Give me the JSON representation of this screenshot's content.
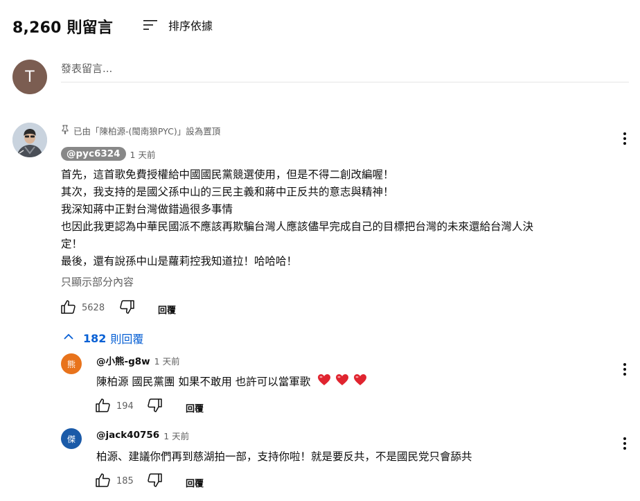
{
  "header": {
    "comment_count_title": "8,260 則留言",
    "sort_label": "排序依據"
  },
  "composer": {
    "avatar_letter": "T",
    "placeholder": "發表留言...",
    "avatar_color": "#7b5d51"
  },
  "pinned_comment": {
    "pinned_text": "已由「陳柏源-(閩南狼PYC)」設為置頂",
    "author": "@pyc6324",
    "time": "1 天前",
    "body_lines": [
      "首先，這首歌免費授權給中國國民黨競選使用，但是不得二創改編喔！",
      "其次，我支持的是國父孫中山的三民主義和蔣中正反共的意志與精神！",
      "我深知蔣中正對台灣做錯過很多事情",
      "也因此我更認為中華民國派不應該再欺騙台灣人應該儘早完成自己的目標把台灣的未來還給台灣人決",
      "定！",
      "最後，還有說孫中山是蘿莉控我知道拉！哈哈哈！"
    ],
    "read_more": "只顯示部分內容",
    "likes": "5628",
    "reply_label": "回覆"
  },
  "replies_toggle": {
    "count": "182",
    "label": "則回覆"
  },
  "replies": [
    {
      "avatar_char": "熊",
      "avatar_color": "#e8731c",
      "author": "@小熊-g8w",
      "time": "1 天前",
      "text": "陳柏源  國民黨團 如果不敢用 也許可以當軍歌",
      "hearts": 3,
      "likes": "194",
      "reply_label": "回覆"
    },
    {
      "avatar_char": "傑",
      "avatar_color": "#1a5aa8",
      "author": "@jack40756",
      "time": "1 天前",
      "text": "柏源、建議你們再到慈湖拍一部，支持你啦！就是要反共，不是國民党只會舔共",
      "hearts": 0,
      "likes": "185",
      "reply_label": "回覆"
    }
  ],
  "colors": {
    "link_blue": "#065fd4",
    "secondary_text": "#606060",
    "heart_red": "#e0242f"
  }
}
